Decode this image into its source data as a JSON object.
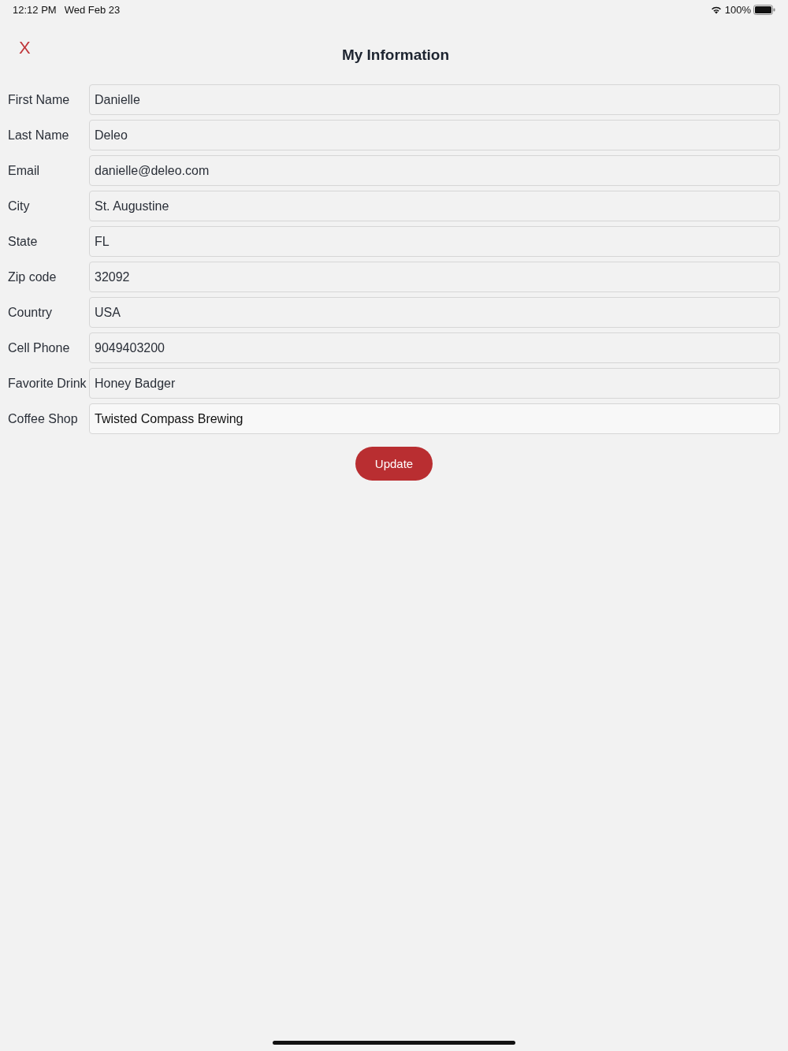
{
  "status_bar": {
    "time": "12:12 PM",
    "date": "Wed Feb 23",
    "battery": "100%"
  },
  "header": {
    "close": "X",
    "title": "My Information"
  },
  "fields": [
    {
      "label": "First Name",
      "value": "Danielle",
      "focused": false
    },
    {
      "label": "Last Name",
      "value": "Deleo",
      "focused": false
    },
    {
      "label": "Email",
      "value": "danielle@deleo.com",
      "focused": false
    },
    {
      "label": "City",
      "value": "St. Augustine",
      "focused": false
    },
    {
      "label": "State",
      "value": "FL",
      "focused": false
    },
    {
      "label": "Zip code",
      "value": "32092",
      "focused": false
    },
    {
      "label": "Country",
      "value": "USA",
      "focused": false
    },
    {
      "label": "Cell Phone",
      "value": "9049403200",
      "focused": false
    },
    {
      "label": "Favorite Drink",
      "value": "Honey Badger",
      "focused": false
    },
    {
      "label": "Coffee Shop",
      "value": "Twisted Compass Brewing",
      "focused": true
    }
  ],
  "submit": "Update"
}
